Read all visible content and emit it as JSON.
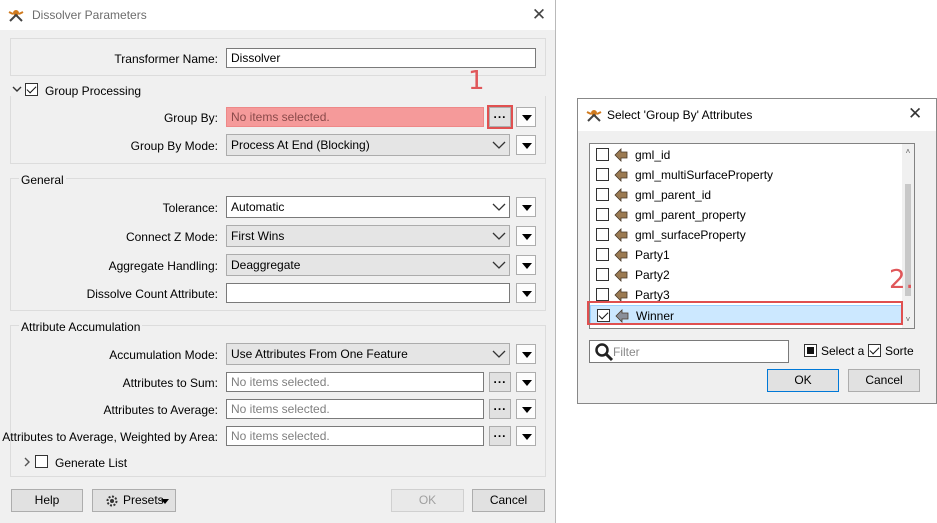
{
  "main_dialog": {
    "title": "Dissolver Parameters",
    "close_glyph": "✕",
    "transformer_name": {
      "label": "Transformer Name:",
      "value": "Dissolver"
    },
    "group_processing": {
      "label": "Group Processing",
      "checked": true,
      "group_by": {
        "label": "Group By:",
        "value": "No items selected."
      },
      "group_by_mode": {
        "label": "Group By Mode:",
        "value": "Process At End (Blocking)"
      }
    },
    "general": {
      "title": "General",
      "tolerance": {
        "label": "Tolerance:",
        "value": "Automatic"
      },
      "connect_z_mode": {
        "label": "Connect Z Mode:",
        "value": "First Wins"
      },
      "aggregate_handling": {
        "label": "Aggregate Handling:",
        "value": "Deaggregate"
      },
      "dissolve_count": {
        "label": "Dissolve Count Attribute:",
        "value": ""
      }
    },
    "attribute_accumulation": {
      "title": "Attribute Accumulation",
      "accumulation_mode": {
        "label": "Accumulation Mode:",
        "value": "Use Attributes From One Feature"
      },
      "attributes_to_sum": {
        "label": "Attributes to Sum:",
        "value": "No items selected."
      },
      "attributes_to_average": {
        "label": "Attributes to Average:",
        "value": "No items selected."
      },
      "attributes_weighted": {
        "label": "Attributes to Average, Weighted by Area:",
        "value": "No items selected."
      }
    },
    "generate_list": {
      "label": "Generate List",
      "checked": false
    },
    "buttons": {
      "help": "Help",
      "presets": "Presets",
      "ok": "OK",
      "cancel": "Cancel"
    },
    "ellipsis": "..."
  },
  "select_dialog": {
    "title": "Select 'Group By' Attributes",
    "close_glyph": "✕",
    "attributes": [
      {
        "name": "gml_id",
        "checked": false
      },
      {
        "name": "gml_multiSurfaceProperty",
        "checked": false
      },
      {
        "name": "gml_parent_id",
        "checked": false
      },
      {
        "name": "gml_parent_property",
        "checked": false
      },
      {
        "name": "gml_surfaceProperty",
        "checked": false
      },
      {
        "name": "Party1",
        "checked": false
      },
      {
        "name": "Party2",
        "checked": false
      },
      {
        "name": "Party3",
        "checked": false
      },
      {
        "name": "Winner",
        "checked": true
      }
    ],
    "filter_placeholder": "Filter",
    "select_all_label": "Select a",
    "sorted_label": "Sorte",
    "sorted_checked": true,
    "select_all_checked": false,
    "buttons": {
      "ok": "OK",
      "cancel": "Cancel"
    }
  },
  "annotations": {
    "step1": "1",
    "step2": "2."
  },
  "colors": {
    "highlight_red": "#e05050",
    "selection_blue": "#cce8ff",
    "error_field": "#f59a9a"
  },
  "icons": {
    "app": "fme-transformer-icon",
    "attribute": "attribute-arrow-icon"
  }
}
